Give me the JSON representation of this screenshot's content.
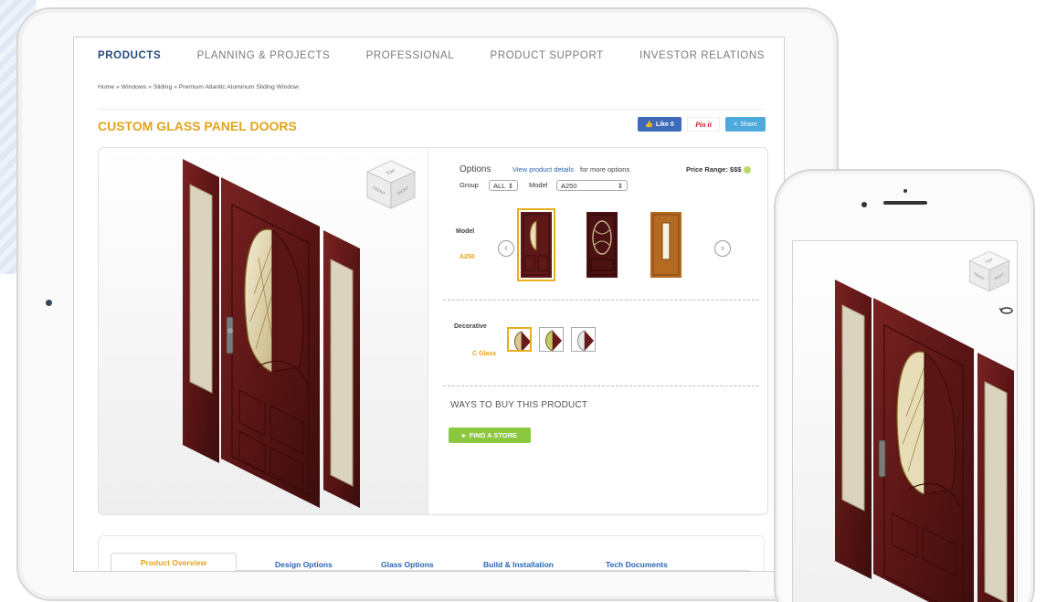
{
  "nav": {
    "items": [
      "PRODUCTS",
      "PLANNING & PROJECTS",
      "PROFESSIONAL",
      "PRODUCT SUPPORT",
      "INVESTOR RELATIONS"
    ],
    "active": "PRODUCTS"
  },
  "breadcrumb": "Home » Windows » Sliding » Premium Atlantic Aluminum Sliding Window",
  "page_title": "CUSTOM GLASS PANEL DOORS",
  "social": {
    "like": "Like 0",
    "pin": "Pin it",
    "share": "Share"
  },
  "viewer": {
    "cube_labels": [
      "TOP",
      "FRONT",
      "RIGHT"
    ]
  },
  "options": {
    "title": "Options",
    "link": "View product details",
    "link_rest": "for more options",
    "price": "Price Range: $$$",
    "group_label": "Group",
    "group_value": "ALL",
    "model_label": "Model",
    "model_value": "A250",
    "model_row_label": "Model",
    "model_row_value": "A250",
    "decorative_label": "Decorative",
    "decorative_value": "C Glass",
    "ways": "WAYS TO BUY THIS PRODUCT",
    "find": "FIND A STORE"
  },
  "tabs": [
    "Product Overview",
    "Design Options",
    "Glass Options",
    "Build & Installation",
    "Tech Documents"
  ],
  "colors": {
    "accent": "#e2a31b",
    "link": "#2a64b4",
    "nav_active": "#234a7b",
    "cta": "#8bc83f",
    "wood": "#6b1d1d"
  }
}
